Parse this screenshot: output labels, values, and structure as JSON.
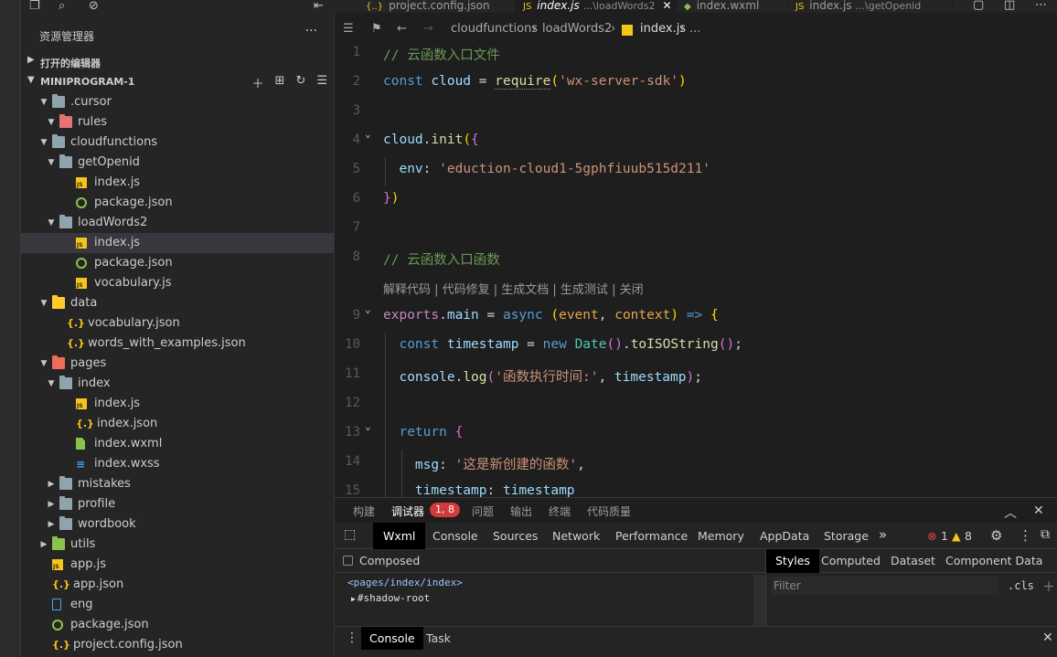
{
  "sidebar": {
    "title": "资源管理器",
    "more": "···",
    "open_editors": "打开的编辑器",
    "project": "MINIPROGRAM-1",
    "tree": [
      {
        "name": ".cursor",
        "type": "folder",
        "depth": 1,
        "open": true
      },
      {
        "name": "rules",
        "type": "folder-rules",
        "depth": 2,
        "open": true
      },
      {
        "name": "cloudfunctions",
        "type": "folder",
        "depth": 1,
        "open": true
      },
      {
        "name": "getOpenid",
        "type": "folder",
        "depth": 2,
        "open": true
      },
      {
        "name": "index.js",
        "type": "js",
        "depth": 3
      },
      {
        "name": "package.json",
        "type": "pkg",
        "depth": 3
      },
      {
        "name": "loadWords2",
        "type": "folder",
        "depth": 2,
        "open": true
      },
      {
        "name": "index.js",
        "type": "js",
        "depth": 3,
        "selected": true
      },
      {
        "name": "package.json",
        "type": "pkg",
        "depth": 3
      },
      {
        "name": "vocabulary.js",
        "type": "js",
        "depth": 3
      },
      {
        "name": "data",
        "type": "folder-data",
        "depth": 1,
        "open": true
      },
      {
        "name": "vocabulary.json",
        "type": "json",
        "depth": 2
      },
      {
        "name": "words_with_examples.json",
        "type": "json",
        "depth": 2
      },
      {
        "name": "pages",
        "type": "folder-pages",
        "depth": 1,
        "open": true
      },
      {
        "name": "index",
        "type": "folder",
        "depth": 2,
        "open": true
      },
      {
        "name": "index.js",
        "type": "js",
        "depth": 3
      },
      {
        "name": "index.json",
        "type": "json",
        "depth": 3
      },
      {
        "name": "index.wxml",
        "type": "wxml",
        "depth": 3
      },
      {
        "name": "index.wxss",
        "type": "wxss",
        "depth": 3
      },
      {
        "name": "mistakes",
        "type": "folder",
        "depth": 2,
        "open": false
      },
      {
        "name": "profile",
        "type": "folder",
        "depth": 2,
        "open": false
      },
      {
        "name": "wordbook",
        "type": "folder",
        "depth": 2,
        "open": false
      },
      {
        "name": "utils",
        "type": "folder-utils",
        "depth": 1,
        "open": false
      },
      {
        "name": "app.js",
        "type": "js",
        "depth": 1
      },
      {
        "name": "app.json",
        "type": "json",
        "depth": 1
      },
      {
        "name": "eng",
        "type": "eng",
        "depth": 1
      },
      {
        "name": "package.json",
        "type": "pkg",
        "depth": 1
      },
      {
        "name": "project.config.json",
        "type": "json",
        "depth": 1
      }
    ]
  },
  "tabs": [
    {
      "label": "project.config.json",
      "icon": "{..}",
      "desc": ""
    },
    {
      "label": "index.js",
      "icon": "JS",
      "desc": "...\\loadWords2",
      "active": true
    },
    {
      "label": "index.wxml",
      "icon": "",
      "desc": ""
    },
    {
      "label": "index.js",
      "icon": "JS",
      "desc": "...\\getOpenid"
    }
  ],
  "breadcrumb": [
    "cloudfunctions",
    "loadWords2",
    "index.js",
    "..."
  ],
  "editor": {
    "codelens": "解释代码 | 代码修复 | 生成文档 | 生成测试 | 关闭",
    "line_numbers": [
      "1",
      "2",
      "3",
      "4",
      "5",
      "6",
      "7",
      "8",
      "9",
      "10",
      "11",
      "12",
      "13",
      "14",
      "15"
    ],
    "line1": "// 云函数入口文件",
    "line8": "// 云函数入口函数",
    "string_sdk": "'wx-server-sdk'",
    "string_env": "'eduction-cloud1-5gphfiuub515d211'",
    "string_log": "'函数执行时间:'",
    "string_msg": "'这是新创建的函数'"
  },
  "panel": {
    "tabs": [
      "构建",
      "调试器",
      "问题",
      "输出",
      "终端",
      "代码质量"
    ],
    "badge": "1, 8",
    "devtools_tabs": [
      "Wxml",
      "Console",
      "Sources",
      "Network",
      "Performance",
      "Memory",
      "AppData",
      "Storage"
    ],
    "more": "»",
    "errors": "1",
    "warnings": "8",
    "composed": "Composed",
    "dom_path": "<pages/index/index>",
    "shadow_root": "#shadow-root",
    "styles_tabs": [
      "Styles",
      "Computed",
      "Dataset",
      "Component Data"
    ],
    "filter_placeholder": "Filter",
    "cls": ".cls",
    "console_tabs": [
      "Console",
      "Task"
    ]
  }
}
